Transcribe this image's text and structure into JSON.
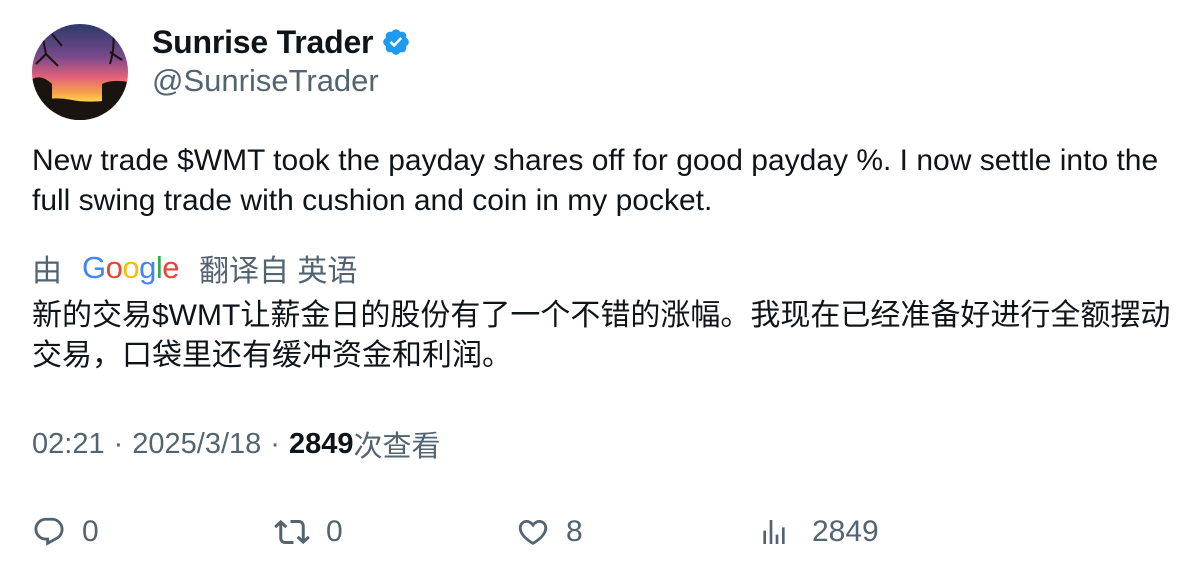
{
  "author": {
    "display_name": "Sunrise Trader",
    "handle": "@SunriseTrader",
    "verified": true,
    "verified_color": "#1d9bf0"
  },
  "tweet": {
    "text": "New trade $WMT took the payday shares off for good payday %.  I now settle into the full swing trade with cushion and coin in my pocket."
  },
  "translation": {
    "by_label": "由",
    "provider": "Google",
    "from_label": "翻译自 英语",
    "text": "新的交易$WMT让薪金日的股份有了一个不错的涨幅。我现在已经准备好进行全额摆动交易，口袋里还有缓冲资金和利润。"
  },
  "meta": {
    "time": "02:21",
    "separator": "·",
    "date": "2025/3/18",
    "views": "2849",
    "views_label": "次查看"
  },
  "actions": {
    "replies": "0",
    "retweets": "0",
    "likes": "8",
    "views": "2849"
  },
  "colors": {
    "text": "#0f1419",
    "secondary": "#536471",
    "google_blue": "#4285f4",
    "google_red": "#ea4335",
    "google_yellow": "#fbbc05",
    "google_green": "#34a853"
  },
  "icons": {
    "reply": "reply-icon",
    "retweet": "retweet-icon",
    "like": "heart-icon",
    "views": "analytics-icon",
    "verified": "verified-badge-icon"
  }
}
